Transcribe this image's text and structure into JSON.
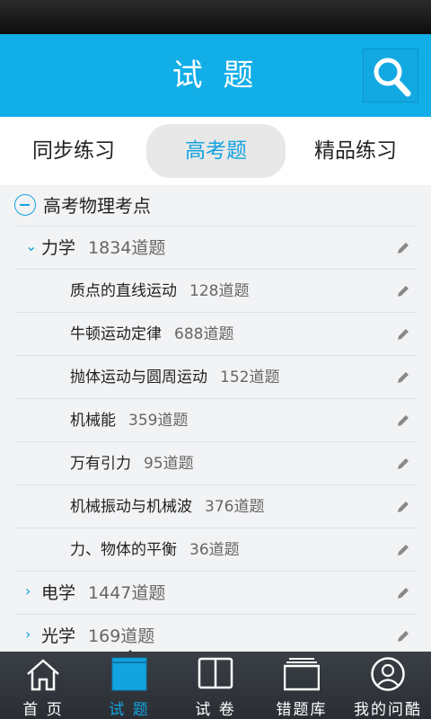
{
  "header": {
    "title": "试 题"
  },
  "tabs": [
    {
      "label": "同步练习"
    },
    {
      "label": "高考题"
    },
    {
      "label": "精品练习"
    }
  ],
  "tree": {
    "root_label": "高考物理考点",
    "rows": [
      {
        "name": "力学",
        "count": "1834道题"
      },
      {
        "name": "质点的直线运动",
        "count": "128道题"
      },
      {
        "name": "牛顿运动定律",
        "count": "688道题"
      },
      {
        "name": "抛体运动与圆周运动",
        "count": "152道题"
      },
      {
        "name": "机械能",
        "count": "359道题"
      },
      {
        "name": "万有引力",
        "count": "95道题"
      },
      {
        "name": "机械振动与机械波",
        "count": "376道题"
      },
      {
        "name": "力、物体的平衡",
        "count": "36道题"
      },
      {
        "name": "电学",
        "count": "1447道题"
      },
      {
        "name": "光学",
        "count": "169道题"
      }
    ],
    "expanded_chevron": "⌄",
    "collapsed_chevron": "›"
  },
  "nav": [
    {
      "label": "首 页",
      "icon": "home-icon"
    },
    {
      "label": "试 题",
      "icon": "questions-icon"
    },
    {
      "label": "试 卷",
      "icon": "book-icon"
    },
    {
      "label": "错题库",
      "icon": "stack-icon"
    },
    {
      "label": "我的问酷",
      "icon": "user-icon"
    }
  ],
  "colors": {
    "accent": "#13a3df",
    "header": "#11aee8",
    "nav_bg": "#2f343a"
  }
}
